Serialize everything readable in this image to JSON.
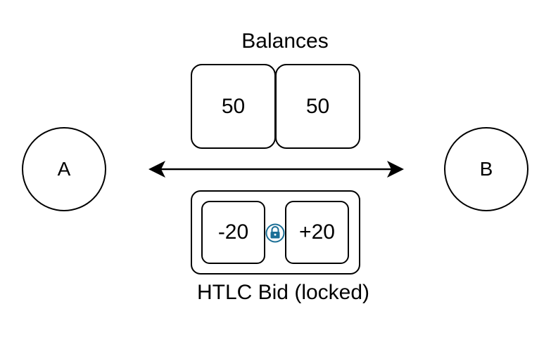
{
  "nodes": {
    "a_label": "A",
    "b_label": "B"
  },
  "balances": {
    "title": "Balances",
    "left_value": "50",
    "right_value": "50"
  },
  "htlc": {
    "title": "HTLC Bid (locked)",
    "left_value": "-20",
    "right_value": "+20",
    "lock_icon": "lock-icon"
  },
  "colors": {
    "stroke": "#000000",
    "lock_ring": "#1b6f96",
    "lock_body": "#1b6f96"
  }
}
